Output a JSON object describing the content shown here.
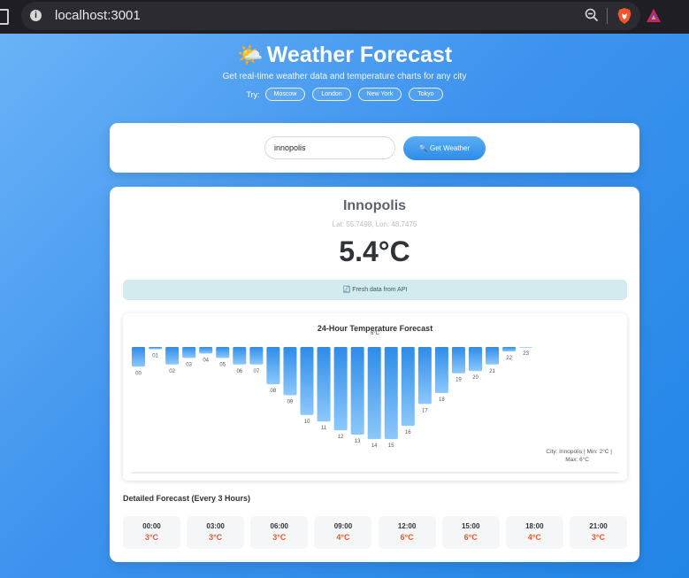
{
  "browser": {
    "url": "localhost:3001"
  },
  "header": {
    "title": "Weather Forecast",
    "title_emoji": "🌤️",
    "subtitle": "Get real-time weather data and temperature charts for any city",
    "try_label": "Try:",
    "quick_cities": [
      "Moscow",
      "London",
      "New York",
      "Tokyo"
    ]
  },
  "search": {
    "input_value": "innopolis",
    "button_icon": "🔍",
    "button_label": "Get Weather"
  },
  "result": {
    "city": "Innopolis",
    "coords": "Lat: 55.7498, Lon: 48.7475",
    "temperature": "5.4°C",
    "status_icon": "🔄",
    "status_text": "Fresh data from API"
  },
  "chart_data": {
    "type": "bar",
    "title": "24-Hour Temperature Forecast",
    "categories": [
      "00",
      "01",
      "02",
      "03",
      "04",
      "05",
      "06",
      "07",
      "08",
      "09",
      "10",
      "11",
      "12",
      "13",
      "14",
      "15",
      "16",
      "17",
      "18",
      "19",
      "20",
      "21",
      "22",
      "23"
    ],
    "values": [
      2.9,
      2.1,
      2.8,
      2.5,
      2.3,
      2.5,
      2.8,
      2.8,
      3.7,
      4.2,
      5.1,
      5.4,
      5.8,
      6.0,
      6.2,
      6.2,
      5.6,
      4.6,
      4.1,
      3.2,
      3.1,
      2.8,
      2.2,
      2.0
    ],
    "ylim": [
      2,
      6.2
    ],
    "peak_label": "6°C",
    "legend_text": "City: Innopolis | Min: 2°C | Max: 6°C",
    "bar_color_top": "#2e8ce8",
    "bar_color_bottom": "#8cc8fb"
  },
  "detailed": {
    "heading": "Detailed Forecast (Every 3 Hours)",
    "items": [
      {
        "time": "00:00",
        "temp": "3°C"
      },
      {
        "time": "03:00",
        "temp": "3°C"
      },
      {
        "time": "06:00",
        "temp": "3°C"
      },
      {
        "time": "09:00",
        "temp": "4°C"
      },
      {
        "time": "12:00",
        "temp": "6°C"
      },
      {
        "time": "15:00",
        "temp": "6°C"
      },
      {
        "time": "18:00",
        "temp": "4°C"
      },
      {
        "time": "21:00",
        "temp": "3°C"
      }
    ]
  }
}
